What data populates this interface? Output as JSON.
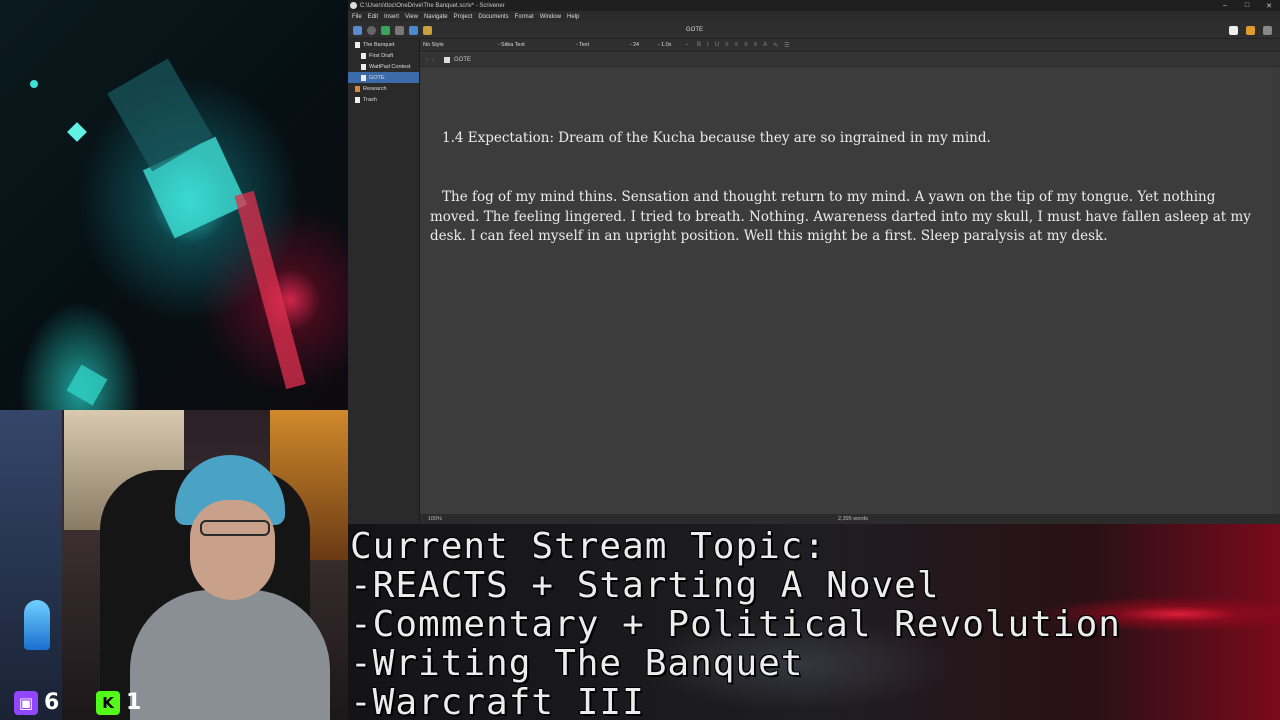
{
  "window": {
    "title": "C:\\Users\\ttoc\\OneDrive\\The Banquet.scriv* - Scrivener",
    "controls": [
      "–",
      "□",
      "✕"
    ]
  },
  "menu": [
    "File",
    "Edit",
    "Insert",
    "View",
    "Navigate",
    "Project",
    "Documents",
    "Format",
    "Window",
    "Help"
  ],
  "toolbar": {
    "document_title": "GOTE"
  },
  "binder": {
    "items": [
      {
        "label": "The Banquet",
        "icon": "project-icon"
      },
      {
        "label": "First Draft",
        "icon": "folder-icon"
      },
      {
        "label": "WattPad Contest",
        "icon": "folder-icon"
      },
      {
        "label": "GOTE",
        "icon": "document-icon",
        "selected": true
      },
      {
        "label": "Research",
        "icon": "research-icon"
      },
      {
        "label": "Trash",
        "icon": "trash-icon"
      }
    ]
  },
  "format_bar": {
    "style": "No Style",
    "font": "Sitka Text",
    "typeface": "Text",
    "size": "24",
    "line_spacing": "1.0x"
  },
  "editor": {
    "header_doc": "GOTE",
    "heading": "1.4 Expectation: Dream of the Kucha because they are so ingrained in my mind.",
    "body": "The fog of my mind thins. Sensation and thought return to my mind. A yawn on the tip of my tongue. Yet nothing moved. The feeling lingered. I tried to breath. Nothing. Awareness darted into my skull, I must have fallen asleep at my desk. I can feel myself in an upright position. Well this might be a first. Sleep paralysis at my desk."
  },
  "status": {
    "zoom": "100%",
    "word_count": "2,395 words"
  },
  "banner": {
    "lines": [
      "Current Stream Topic:",
      "-REACTS + Starting A Novel",
      "-Commentary + Political Revolution",
      "-Writing The Banquet",
      "-Warcraft III"
    ]
  },
  "social": {
    "twitch_count": "6",
    "kick_count": "1",
    "twitch_color": "#9146ff",
    "kick_color": "#53fc18"
  },
  "colors": {
    "selection": "#3d6aa8",
    "editor_bg": "#3c3c3c"
  }
}
